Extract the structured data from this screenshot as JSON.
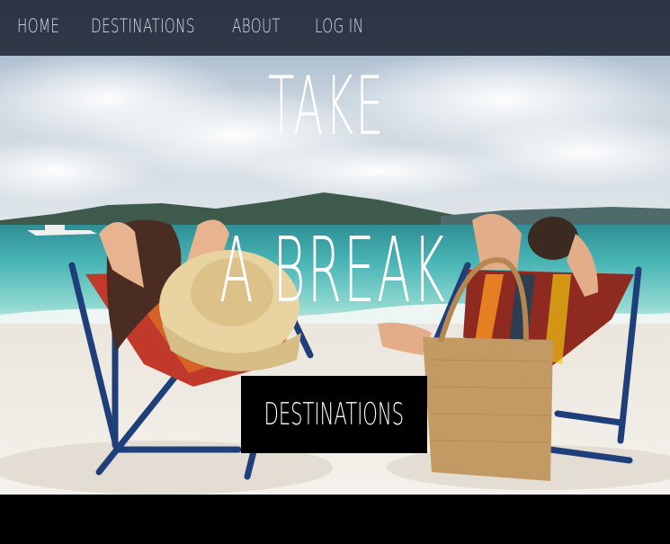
{
  "nav": {
    "items": [
      {
        "label": "HOME"
      },
      {
        "label": "DESTINATIONS"
      },
      {
        "label": "ABOUT"
      },
      {
        "label": "LOG IN"
      }
    ]
  },
  "hero": {
    "title_line_1": "TAKE",
    "title_line_2": "A BREAK",
    "cta_label": "DESTINATIONS",
    "image_subject": "couple relaxing in beach chairs facing the sea"
  },
  "colors": {
    "nav_background": "#1e2634",
    "nav_text": "#d8dde6",
    "title_text": "#ffffff",
    "cta_background": "#000000",
    "page_background": "#000000"
  }
}
